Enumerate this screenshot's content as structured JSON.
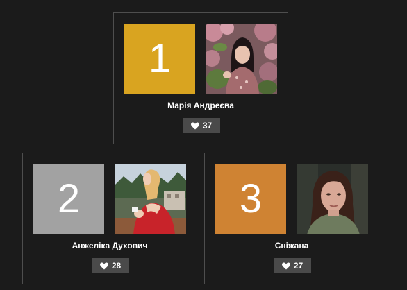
{
  "leaderboard": [
    {
      "rank": "1",
      "rank_color": "#d9a420",
      "name": "Марія Андреєва",
      "likes": "37",
      "photo": "woman-with-blossoms"
    },
    {
      "rank": "2",
      "rank_color": "#a2a2a2",
      "name": "Анжеліка Духович",
      "likes": "28",
      "photo": "woman-in-red-dress"
    },
    {
      "rank": "3",
      "rank_color": "#cf8333",
      "name": "Сніжана",
      "likes": "27",
      "photo": "woman-portrait-green-top"
    }
  ],
  "icons": {
    "like": "heart-icon"
  }
}
